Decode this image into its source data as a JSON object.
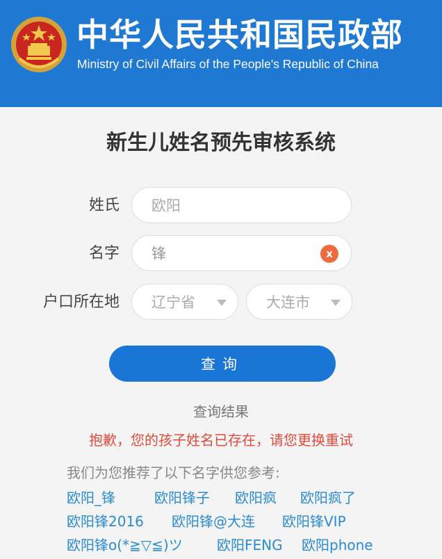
{
  "header": {
    "title": "中华人民共和国民政部",
    "subtitle": "Ministry of Civil Affairs of the People's Republic of China",
    "emblem_icon": "national-emblem-icon"
  },
  "page_title": "新生儿姓名预先审核系统",
  "form": {
    "surname_label": "姓氏",
    "surname_value": "欧阳",
    "given_label": "名字",
    "given_value": "锋",
    "hukou_label": "户口所在地",
    "province_value": "辽宁省",
    "city_value": "大连市",
    "clear_icon_glyph": "x"
  },
  "query_button_label": "查询",
  "result": {
    "heading": "查询结果",
    "error": "抱歉，您的孩子姓名已存在，请您更换重试",
    "suggest_intro": "我们为您推荐了以下名字供您参考:",
    "suggestions": [
      "欧阳_锋",
      "欧阳锋子",
      "欧阳疯",
      "欧阳疯了",
      "欧阳锋2016",
      "欧阳锋@大连",
      "欧阳锋VIP",
      "欧阳锋o(*≧▽≦)ツ",
      "欧阳FENG",
      "欧阳phone"
    ]
  },
  "colors": {
    "header_blue": "#1f78d1",
    "button_blue": "#1a76d6",
    "error_red": "#e24a3b",
    "link_blue": "#2a8bd6",
    "clear_orange": "#f06a3e"
  }
}
